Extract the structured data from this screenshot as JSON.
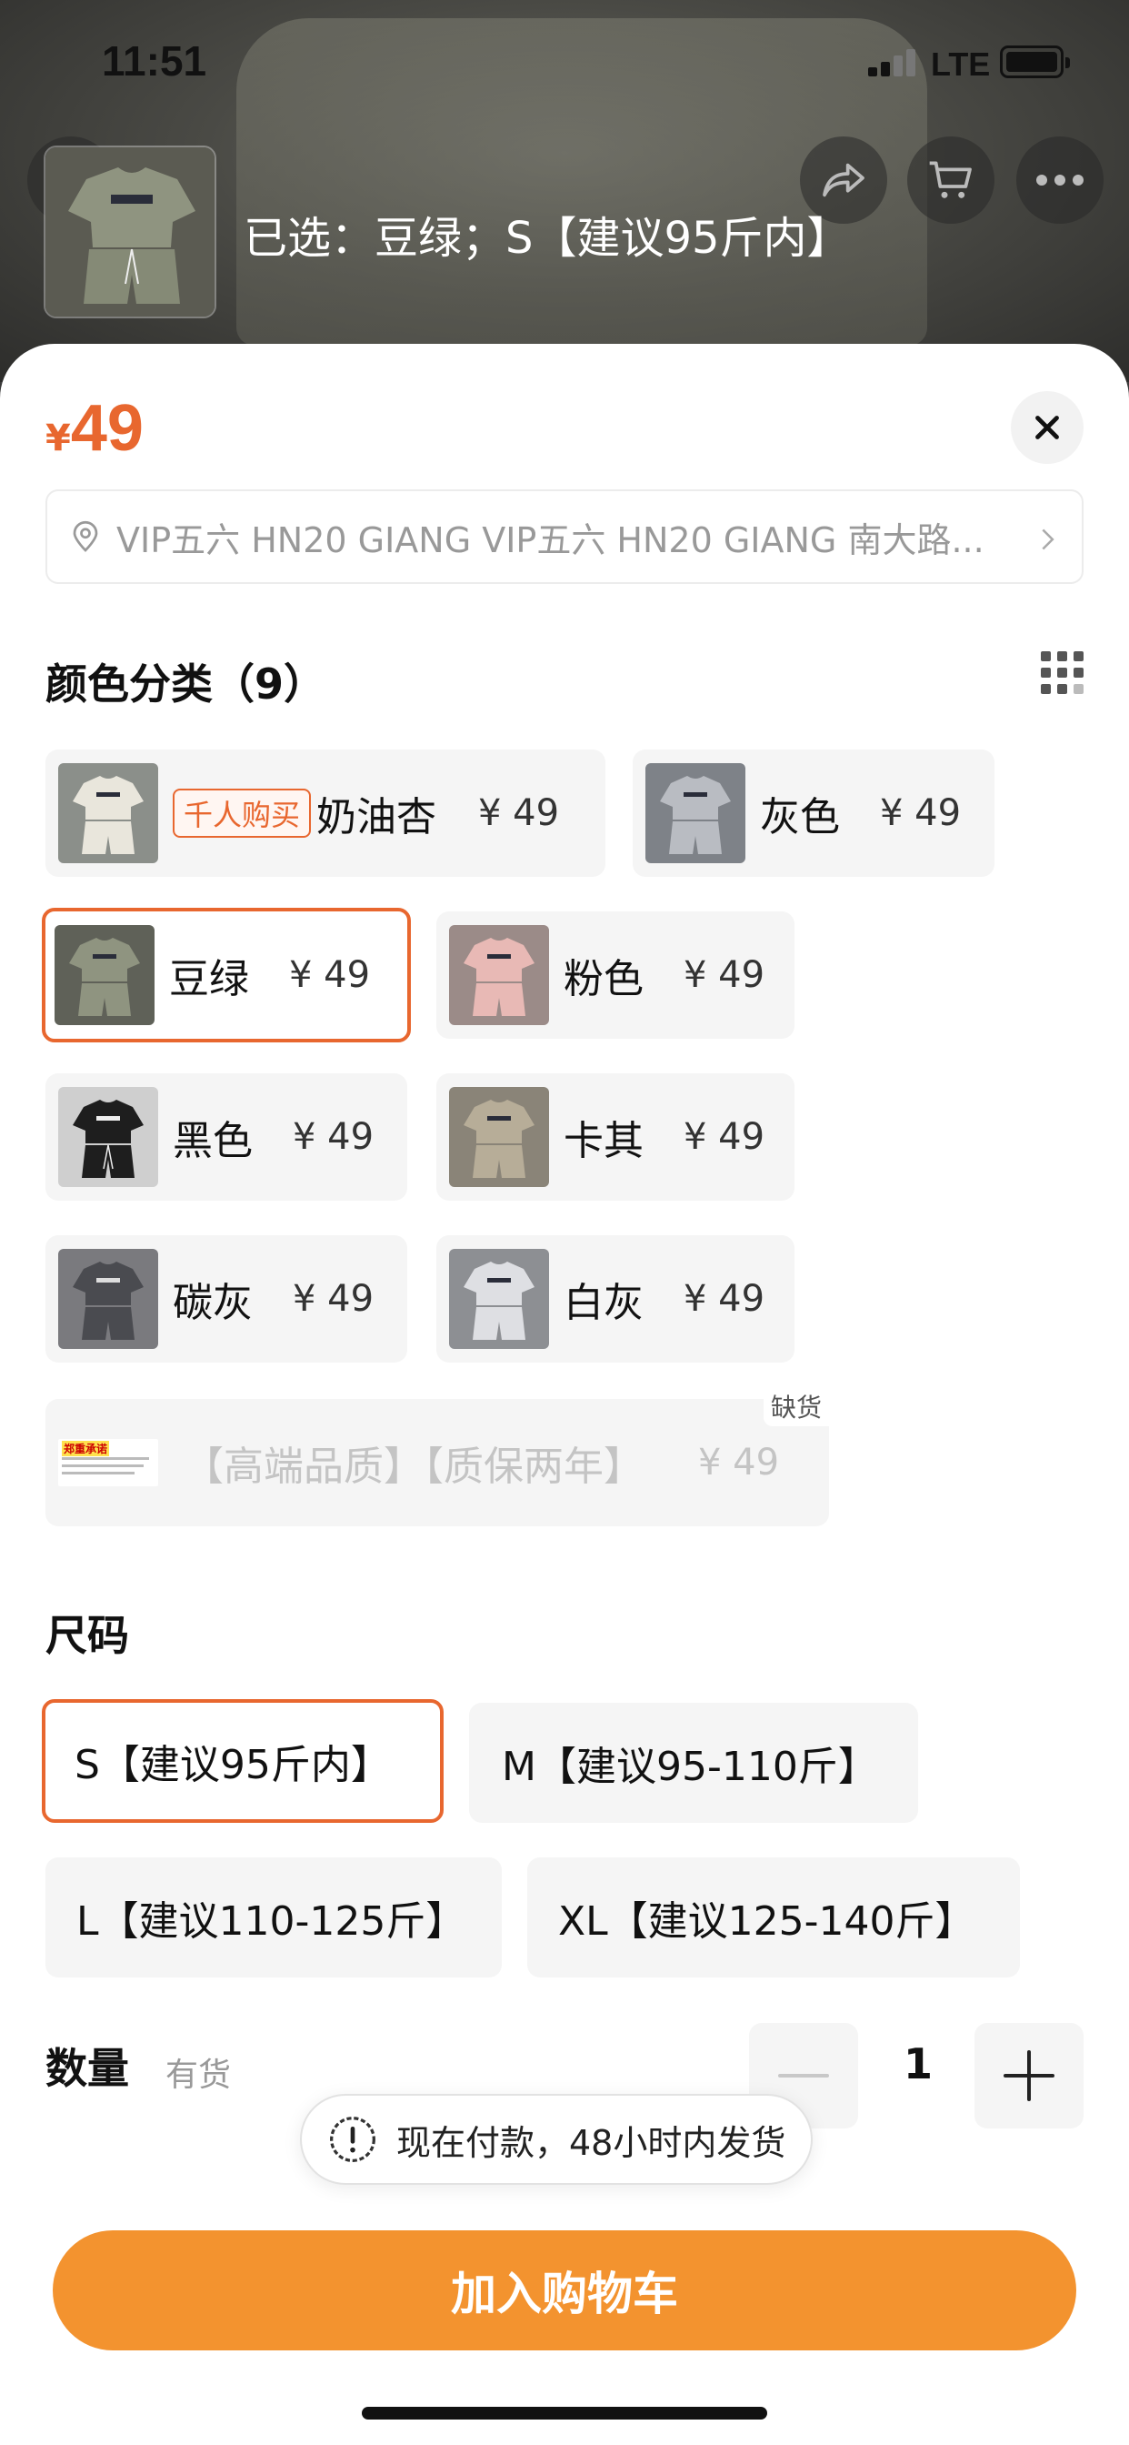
{
  "status_bar": {
    "time": "11:51",
    "network": "LTE"
  },
  "header": {
    "selected_text": "已选：豆绿；S【建议95斤内】"
  },
  "sheet": {
    "price_symbol": "¥",
    "price_value": "49",
    "address": "VIP五六 HN20 GIANG VIP五六 HN20 GIANG 南大路..."
  },
  "color_section": {
    "title": "颜色分类（9）",
    "options": [
      {
        "label": "奶油杏",
        "price": "¥ 49",
        "badge": "千人购买",
        "swatch": "#e9e6dc"
      },
      {
        "label": "灰色",
        "price": "¥ 49",
        "swatch": "#b9bcc2"
      },
      {
        "label": "豆绿",
        "price": "¥ 49",
        "selected": true,
        "swatch": "#8f9480"
      },
      {
        "label": "粉色",
        "price": "¥ 49",
        "swatch": "#e8b9b5"
      },
      {
        "label": "黑色",
        "price": "¥ 49",
        "swatch": "#1e1e1e"
      },
      {
        "label": "卡其",
        "price": "¥ 49",
        "swatch": "#b7ad98"
      },
      {
        "label": "碳灰",
        "price": "¥ 49",
        "swatch": "#4a4b50"
      },
      {
        "label": "白灰",
        "price": "¥ 49",
        "swatch": "#dedfe3"
      },
      {
        "label": "【高端品质】【质保两年】",
        "price": "¥ 49",
        "disabled": true,
        "tag": "缺货",
        "thumb_title": "郑重承诺"
      }
    ]
  },
  "size_section": {
    "title": "尺码",
    "options": [
      {
        "label": "S【建议95斤内】",
        "selected": true
      },
      {
        "label": "M【建议95-110斤】"
      },
      {
        "label": "L【建议110-125斤】"
      },
      {
        "label": "XL【建议125-140斤】"
      }
    ]
  },
  "quantity": {
    "label": "数量",
    "stock": "有货",
    "value": "1"
  },
  "toast": {
    "text": "现在付款，48小时内发货"
  },
  "add_to_cart": {
    "label": "加入购物车"
  },
  "colors": {
    "accent": "#e8672f",
    "button": "#f3932f"
  }
}
